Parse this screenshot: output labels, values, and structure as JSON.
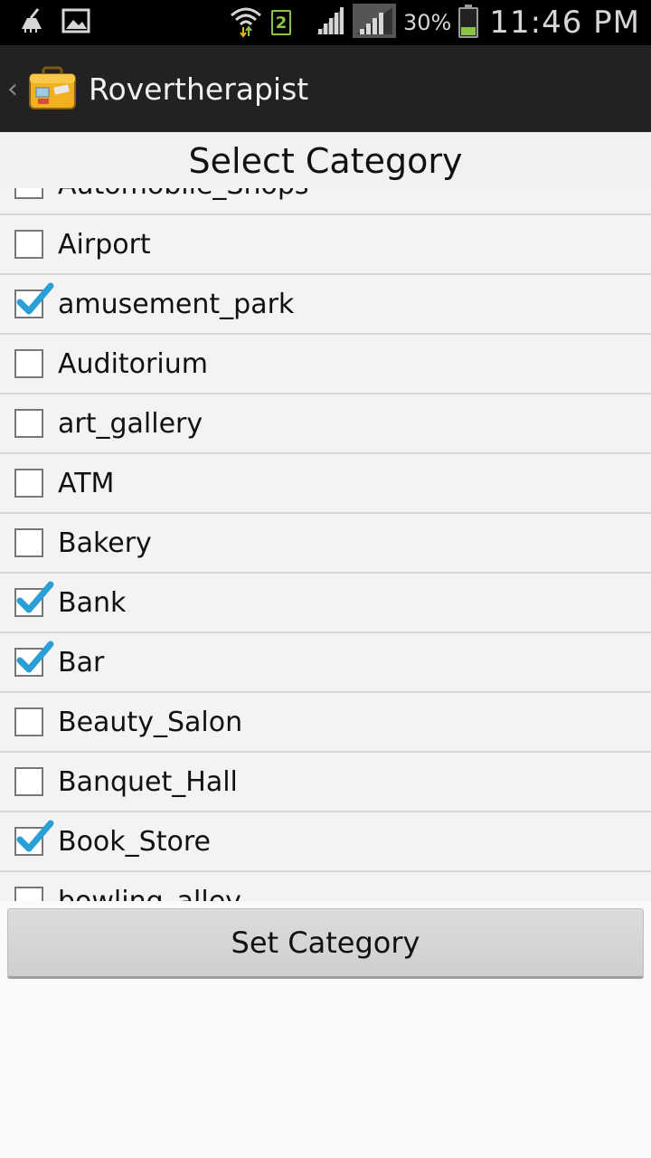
{
  "status_bar": {
    "sim_number": "2",
    "battery_percent": "30%",
    "battery_level": 0.3,
    "time": "11:46 PM",
    "icons": [
      "broom-icon",
      "image-icon",
      "wifi-icon",
      "sim-icon",
      "signal-icon",
      "signal-icon-2",
      "battery-icon"
    ]
  },
  "action_bar": {
    "title": "Rovertherapist",
    "up_icon": "chevron-left-icon",
    "app_icon": "suitcase-icon"
  },
  "page": {
    "title": "Select Category"
  },
  "categories": [
    {
      "label": "Automobile_Shops",
      "checked": false
    },
    {
      "label": "Airport",
      "checked": false
    },
    {
      "label": "amusement_park",
      "checked": true
    },
    {
      "label": "Auditorium",
      "checked": false
    },
    {
      "label": "art_gallery",
      "checked": false
    },
    {
      "label": "ATM",
      "checked": false
    },
    {
      "label": "Bakery",
      "checked": false
    },
    {
      "label": "Bank",
      "checked": true
    },
    {
      "label": "Bar",
      "checked": true
    },
    {
      "label": "Beauty_Salon",
      "checked": false
    },
    {
      "label": "Banquet_Hall",
      "checked": false
    },
    {
      "label": "Book_Store",
      "checked": true
    },
    {
      "label": "bowling_alley",
      "checked": false
    }
  ],
  "colors": {
    "check_blue": "#2a9fd6",
    "status_green": "#8bc34a"
  },
  "button": {
    "label": "Set Category"
  }
}
